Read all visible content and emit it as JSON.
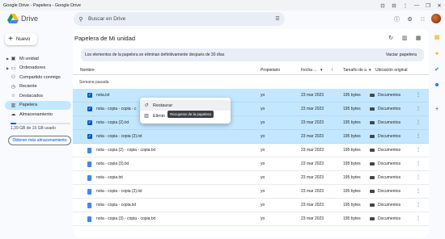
{
  "window": {
    "title": "Google Drive - Papelera - Google Drive",
    "controls": [
      "⊡",
      "⊟",
      "⋮",
      "—",
      "❐",
      "✕"
    ]
  },
  "header": {
    "brand": "Drive",
    "search_placeholder": "Buscar en Drive"
  },
  "sidebar": {
    "new_button": "Nuevo",
    "items": [
      {
        "label": "Mi unidad",
        "icon": "drive-icon",
        "glyph": "▣",
        "caret": true
      },
      {
        "label": "Ordenadores",
        "icon": "computer-icon",
        "glyph": "▭",
        "caret": true
      },
      {
        "label": "Compartido conmigo",
        "icon": "people-icon",
        "glyph": "⚇",
        "caret": false
      },
      {
        "label": "Reciente",
        "icon": "clock-icon",
        "glyph": "◷",
        "caret": false
      },
      {
        "label": "Destacados",
        "icon": "star-icon",
        "glyph": "☆",
        "caret": false
      },
      {
        "label": "Papelera",
        "icon": "trash-icon",
        "glyph": "▥",
        "caret": false,
        "active": true
      },
      {
        "label": "Almacenamiento",
        "icon": "cloud-icon",
        "glyph": "☁",
        "caret": false
      }
    ],
    "storage_text": "1,39 GB de 15 GB usado",
    "storage_fraction": 0.093,
    "get_storage": "Obtener más almacenamiento"
  },
  "main": {
    "title": "Papelera de Mi unidad",
    "banner_text": "Los elementos de la papelera se eliminan definitivamente después de 30 días",
    "banner_button": "Vaciar papelera",
    "columns": {
      "name": "Nombre",
      "owner": "Propietario",
      "date": "Fecha ...",
      "size": "Tamaño de a",
      "location": "Ubicación original"
    },
    "section": "Semana pasada",
    "rows": [
      {
        "name": "nota.txt",
        "owner": "yo",
        "date": "23 mar 2023",
        "size": "195 bytes",
        "location": "Documentos",
        "selected": true
      },
      {
        "name": "nota - copia - copia - c",
        "owner": "yo",
        "date": "23 mar 2023",
        "size": "195 bytes",
        "location": "Documentos",
        "selected": true
      },
      {
        "name": "nota - copia (2).txt",
        "owner": "yo",
        "date": "23 mar 2023",
        "size": "195 bytes",
        "location": "Documentos",
        "selected": true
      },
      {
        "name": "nota - copia - copia (2).txt",
        "owner": "yo",
        "date": "23 mar 2023",
        "size": "195 bytes",
        "location": "Documentos",
        "selected": true
      },
      {
        "name": "nota - copia (2) - copia - copia.txt",
        "owner": "yo",
        "date": "23 mar 2023",
        "size": "195 bytes",
        "location": "Documentos",
        "selected": false
      },
      {
        "name": "nota - copia (3).txt",
        "owner": "yo",
        "date": "23 mar 2023",
        "size": "195 bytes",
        "location": "Documentos",
        "selected": false
      },
      {
        "name": "nota - copia.txt",
        "owner": "yo",
        "date": "23 mar 2023",
        "size": "195 bytes",
        "location": "Documentos",
        "selected": false
      },
      {
        "name": "nota - copia - copia (2).txt",
        "owner": "yo",
        "date": "23 mar 2023",
        "size": "195 bytes",
        "location": "Documentos",
        "selected": false
      },
      {
        "name": "nota - copia - copia.txt",
        "owner": "yo",
        "date": "23 mar 2023",
        "size": "195 bytes",
        "location": "Documentos",
        "selected": false
      },
      {
        "name": "nota - copia (3) - copia - copia.txt",
        "owner": "yo",
        "date": "23 mar 2023",
        "size": "195 bytes",
        "location": "Documentos",
        "selected": false
      }
    ]
  },
  "context_menu": {
    "restore": "Restaurar",
    "delete": "Elimin",
    "tooltip": "Recuperar de la papelera"
  },
  "colors": {
    "selected_row": "#c2e7ff",
    "accent": "#0b57d0"
  }
}
